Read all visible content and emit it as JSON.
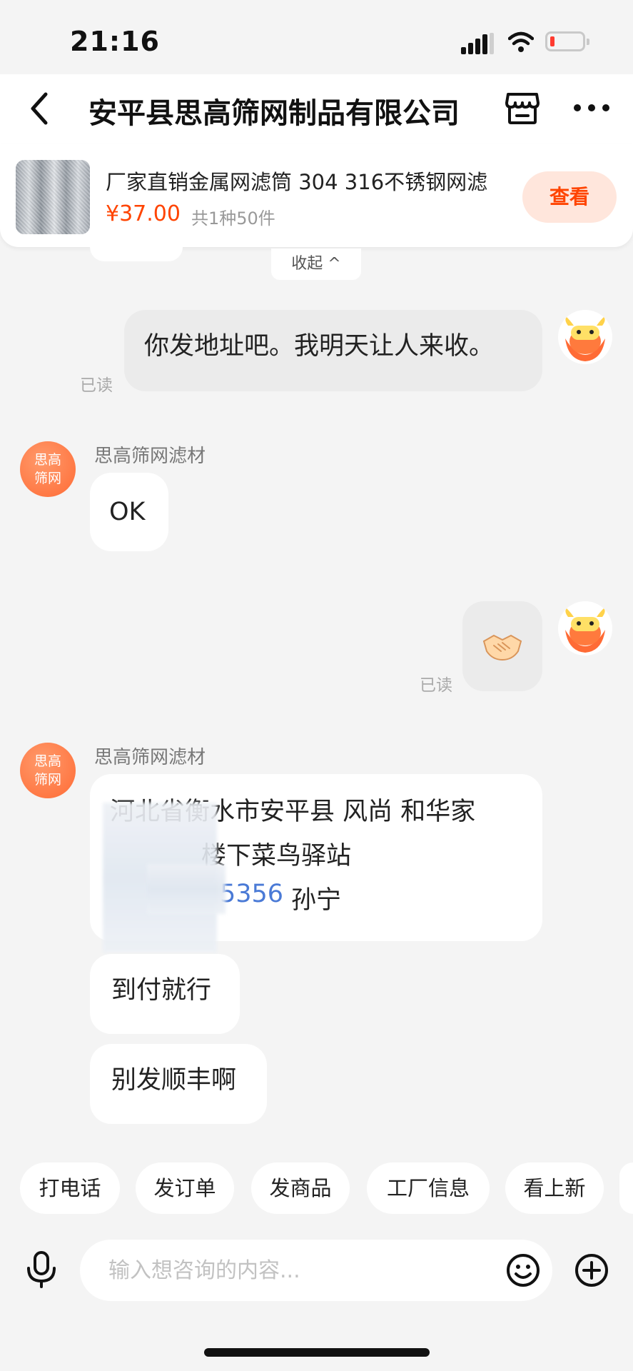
{
  "status_bar": {
    "time": "21:16"
  },
  "header": {
    "title": "安平县思高筛网制品有限公司",
    "icons": [
      "back-chevron-icon",
      "shop-icon",
      "more-icon"
    ]
  },
  "product_card": {
    "title": "厂家直销金属网滤筒 304 316不锈钢网滤",
    "price": "¥37.00",
    "count": "共1种50件",
    "view_label": "查看",
    "collapse_label": "收起 ^"
  },
  "messages": {
    "m1": {
      "text": "你发地址吧。我明天让人来收。",
      "read": "已读"
    },
    "m2": {
      "sender": "思高筛网滤材",
      "text": "OK",
      "avatar_line1": "思高",
      "avatar_line2": "筛网"
    },
    "m3": {
      "emoji": "handshake-emoji",
      "read": "已读"
    },
    "m4": {
      "sender": "思高筛网滤材",
      "avatar_line1": "思高",
      "avatar_line2": "筛网",
      "line1": "河北省衡水市安平县 风尚 和华家",
      "line2": "楼下菜鸟驿站",
      "line3_num": "5356",
      "line3_name": "孙宁"
    },
    "m5": {
      "text": "到付就行"
    },
    "m6": {
      "text": "别发顺丰啊"
    }
  },
  "quick_actions": [
    "打电话",
    "发订单",
    "发商品",
    "工厂信息",
    "看上新"
  ],
  "input": {
    "placeholder": "输入想咨询的内容..."
  },
  "colors": {
    "accent": "#ff4400",
    "avatar_orange": "#ff6b35",
    "background": "#f4f4f4"
  }
}
